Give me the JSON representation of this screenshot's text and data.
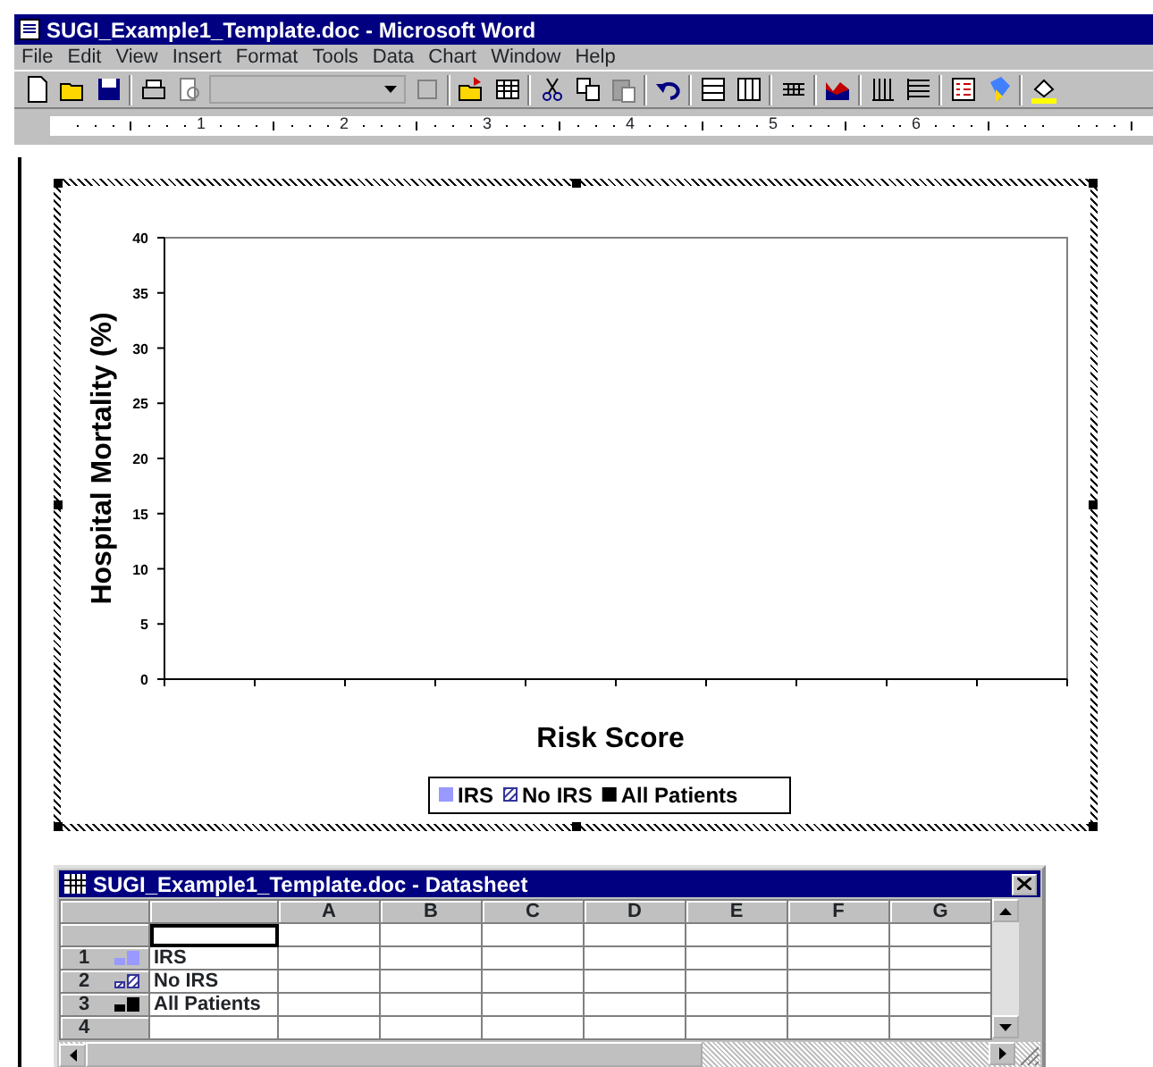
{
  "window": {
    "title": "SUGI_Example1_Template.doc - Microsoft Word"
  },
  "menu": [
    {
      "label": "File"
    },
    {
      "label": "Edit"
    },
    {
      "label": "View"
    },
    {
      "label": "Insert"
    },
    {
      "label": "Format"
    },
    {
      "label": "Tools"
    },
    {
      "label": "Data"
    },
    {
      "label": "Chart"
    },
    {
      "label": "Window"
    },
    {
      "label": "Help"
    }
  ],
  "ruler": {
    "labels": [
      "1",
      "2",
      "3",
      "4",
      "5",
      "6"
    ]
  },
  "chart": {
    "selected": true,
    "series_hatched": [
      false,
      true,
      false
    ],
    "chart_data": {
      "type": "bar",
      "xlabel": "Risk Score",
      "ylabel": "Hospital Mortality (%)",
      "ylim": [
        0,
        40
      ],
      "yticks": [
        0,
        5,
        10,
        15,
        20,
        25,
        30,
        35,
        40
      ],
      "series": [
        {
          "name": "IRS",
          "color": "#9999ff"
        },
        {
          "name": "No IRS",
          "color": "#333399"
        },
        {
          "name": "All Patients",
          "color": "#000000"
        }
      ]
    }
  },
  "datasheet": {
    "title": "SUGI_Example1_Template.doc - Datasheet",
    "columns": [
      "A",
      "B",
      "C",
      "D",
      "E",
      "F",
      "G"
    ],
    "rows": [
      {
        "header": "",
        "label": "",
        "selected": true
      },
      {
        "header": "1",
        "label": "IRS",
        "marker": {
          "color": "#9999ff",
          "hatched": false
        },
        "selected": false
      },
      {
        "header": "2",
        "label": "No IRS",
        "marker": {
          "color": "#333399",
          "hatched": true
        },
        "selected": false
      },
      {
        "header": "3",
        "label": "All Patients",
        "marker": {
          "color": "#000000",
          "hatched": false
        },
        "selected": false
      },
      {
        "header": "4",
        "label": "",
        "selected": false
      }
    ]
  }
}
